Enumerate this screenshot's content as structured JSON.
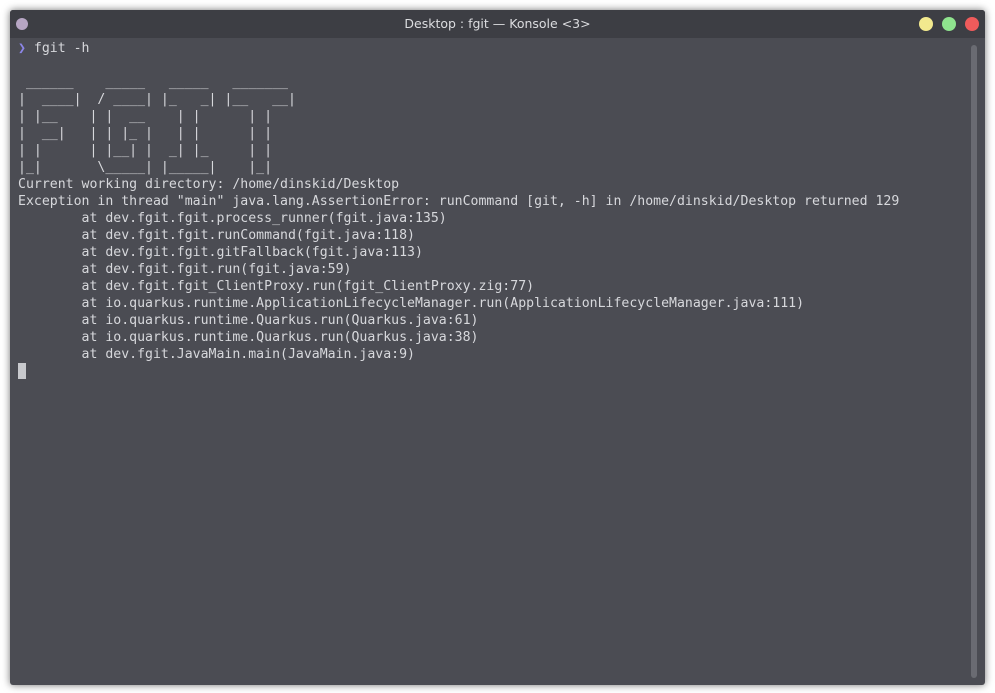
{
  "window": {
    "title": "Desktop : fgit — Konsole <3>"
  },
  "colors": {
    "background": "#4b4c53",
    "titlebar": "#3d3e44",
    "text": "#d7d8dc",
    "prompt": "#8c86e8",
    "minimize": "#f2e98e",
    "maximize": "#8fe38e",
    "close": "#ef5b5b",
    "menu_dot": "#b7a6c4"
  },
  "icons": {
    "menu": "window-menu-icon",
    "minimize": "minimize-button",
    "maximize": "maximize-button",
    "close": "close-button"
  },
  "terminal": {
    "prompt_symbol": "❯",
    "command": " fgit -h",
    "lines": [
      "",
      " ______    _____   _____   _______",
      "|  ____|  / ____| |_   _| |__   __|",
      "| |__    | |  __    | |      | |",
      "|  __|   | | |_ |   | |      | |",
      "| |      | |__| |  _| |_     | |",
      "|_|       \\_____| |_____|    |_|",
      "Current working directory: /home/dinskid/Desktop",
      "Exception in thread \"main\" java.lang.AssertionError: runCommand [git, -h] in /home/dinskid/Desktop returned 129",
      "        at dev.fgit.fgit.process_runner(fgit.java:135)",
      "        at dev.fgit.fgit.runCommand(fgit.java:118)",
      "        at dev.fgit.fgit.gitFallback(fgit.java:113)",
      "        at dev.fgit.fgit.run(fgit.java:59)",
      "        at dev.fgit.fgit_ClientProxy.run(fgit_ClientProxy.zig:77)",
      "        at io.quarkus.runtime.ApplicationLifecycleManager.run(ApplicationLifecycleManager.java:111)",
      "        at io.quarkus.runtime.Quarkus.run(Quarkus.java:61)",
      "        at io.quarkus.runtime.Quarkus.run(Quarkus.java:38)",
      "        at dev.fgit.JavaMain.main(JavaMain.java:9)"
    ]
  }
}
